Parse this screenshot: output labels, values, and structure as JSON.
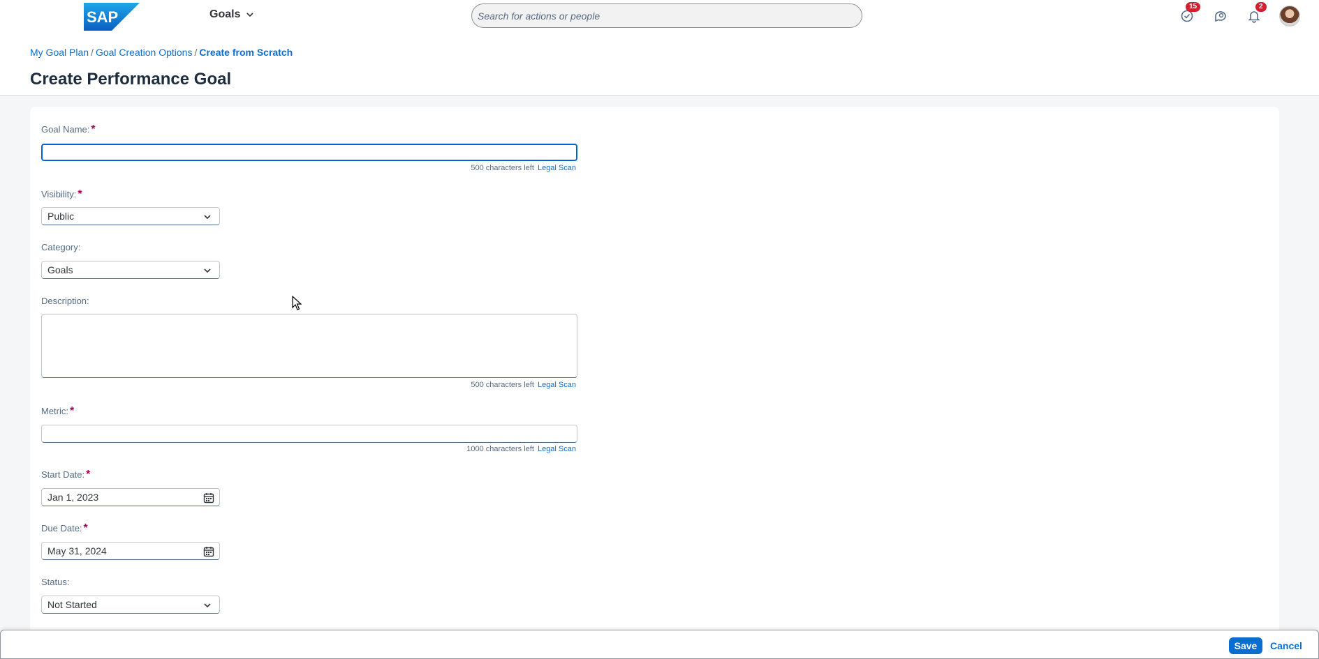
{
  "shell": {
    "logo_text": "SAP",
    "app_title": "Goals",
    "search_placeholder": "Search for actions or people",
    "tasks_badge": "15",
    "notifications_badge": "2"
  },
  "breadcrumb": {
    "items": [
      "My Goal Plan",
      "Goal Creation Options"
    ],
    "current": "Create from Scratch",
    "separator": "/"
  },
  "page_title": "Create Performance Goal",
  "form": {
    "goal_name": {
      "label": "Goal Name:",
      "value": "",
      "counter": "500 characters left",
      "scan": "Legal Scan"
    },
    "visibility": {
      "label": "Visibility:",
      "value": "Public"
    },
    "category": {
      "label": "Category:",
      "value": "Goals"
    },
    "description": {
      "label": "Description:",
      "value": "",
      "counter": "500 characters left",
      "scan": "Legal Scan"
    },
    "metric": {
      "label": "Metric:",
      "value": "",
      "counter": "1000 characters left",
      "scan": "Legal Scan"
    },
    "start_date": {
      "label": "Start Date:",
      "value": "Jan 1, 2023"
    },
    "due_date": {
      "label": "Due Date:",
      "value": "May 31, 2024"
    },
    "status": {
      "label": "Status:",
      "value": "Not Started"
    }
  },
  "footer": {
    "save_label": "Save",
    "cancel_label": "Cancel"
  },
  "colors": {
    "accent": "#0a6ed1",
    "required": "#b0005c",
    "badge": "#d32030"
  }
}
